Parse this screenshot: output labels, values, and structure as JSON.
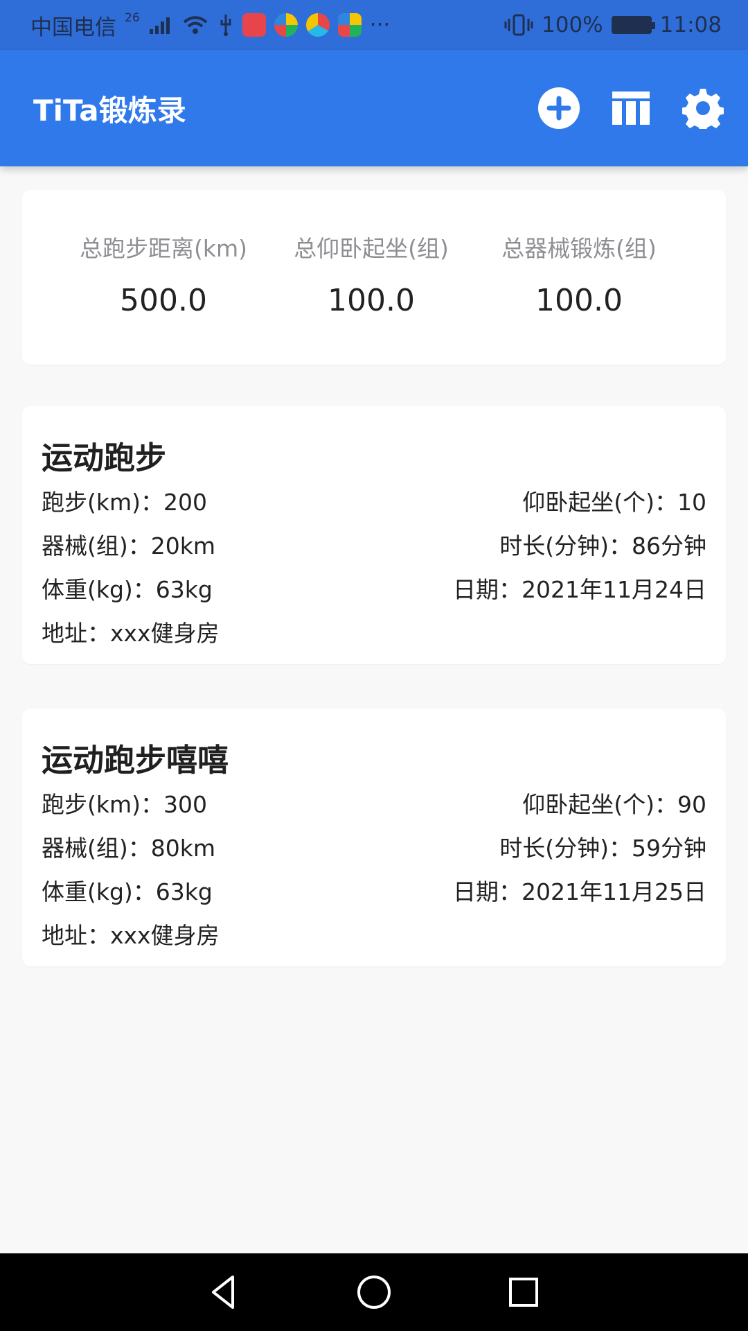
{
  "status_bar": {
    "carrier": "中国电信",
    "network": "26",
    "more": "···",
    "battery": "100%",
    "time": "11:08"
  },
  "app_bar": {
    "title": "TiTa锻炼录"
  },
  "summary": [
    {
      "label": "总跑步距离(km)",
      "value": "500.0"
    },
    {
      "label": "总仰卧起坐(组)",
      "value": "100.0"
    },
    {
      "label": "总器械锻炼(组)",
      "value": "100.0"
    }
  ],
  "records": [
    {
      "title": "运动跑步",
      "run": "跑步(km)：200",
      "situp": "仰卧起坐(个)：10",
      "equipment": "器械(组)：20km",
      "duration": "时长(分钟)：86分钟",
      "weight": "体重(kg)：63kg",
      "date": "日期：2021年11月24日",
      "address": "地址：xxx健身房"
    },
    {
      "title": "运动跑步嘻嘻",
      "run": "跑步(km)：300",
      "situp": "仰卧起坐(个)：90",
      "equipment": "器械(组)：80km",
      "duration": "时长(分钟)：59分钟",
      "weight": "体重(kg)：63kg",
      "date": "日期：2021年11月25日",
      "address": "地址：xxx健身房"
    }
  ],
  "colors": {
    "primary": "#2f79eb",
    "status_bar": "#2f6ed9",
    "background": "#f8f8f9",
    "card": "#ffffff",
    "text": "#222222",
    "secondary_text": "#8e8e93"
  }
}
